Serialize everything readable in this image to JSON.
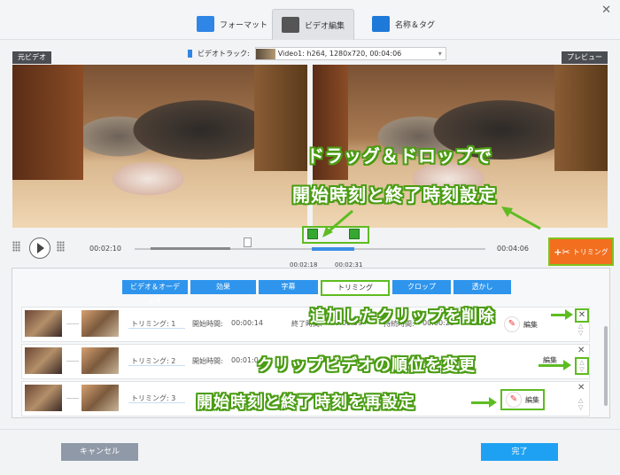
{
  "window": {
    "close": "✕"
  },
  "top_tabs": [
    {
      "label": "フォーマット",
      "active": false
    },
    {
      "label": "ビデオ編集",
      "active": true
    },
    {
      "label": "名称＆タグ",
      "active": false
    }
  ],
  "preview": {
    "original_label": "元ビデオ",
    "preview_label": "プレビュー",
    "track_label": "ビデオトラック:",
    "track_value": "Video1: h264, 1280x720, 00:04:06"
  },
  "timeline": {
    "current_time": "00:02:10",
    "total_time": "00:04:06",
    "trim_start": "00:02:18",
    "trim_end": "00:02:31",
    "trim_button": "トリミング"
  },
  "sub_tabs": [
    "ビデオ＆オーディオ",
    "効果",
    "字幕",
    "トリミング",
    "クロップ",
    "透かし"
  ],
  "sub_tab_active": "トリミング",
  "clips": [
    {
      "name": "トリミング: 1",
      "start_label": "開始時間:",
      "start": "00:00:14",
      "end_label": "終了時間:",
      "end": "00:00:39",
      "dur_label": "持続時間:",
      "dur": "00:00:25",
      "edit": "編集"
    },
    {
      "name": "トリミング: 2",
      "start_label": "開始時間:",
      "start": "00:01:0",
      "end_label": "",
      "end": "",
      "dur_label": "",
      "dur": "",
      "edit": "編集"
    },
    {
      "name": "トリミング: 3",
      "start_label": "",
      "start": "",
      "end_label": "",
      "end": "",
      "dur_label": "",
      "dur": "",
      "edit": "編集"
    }
  ],
  "annotations": {
    "drag": "ドラッグ＆ドロップで",
    "set_time": "開始時刻と終了時刻設定",
    "delete": "追加したクリップを削除",
    "order": "クリップビデオの順位を変更",
    "reset": "開始時刻と終了時刻を再設定"
  },
  "buttons": {
    "cancel": "キャンセル",
    "done": "完了"
  },
  "colors": {
    "accent_blue": "#2f95ec",
    "trim_orange": "#f26f1f",
    "annotation_green": "#5ebc22"
  }
}
